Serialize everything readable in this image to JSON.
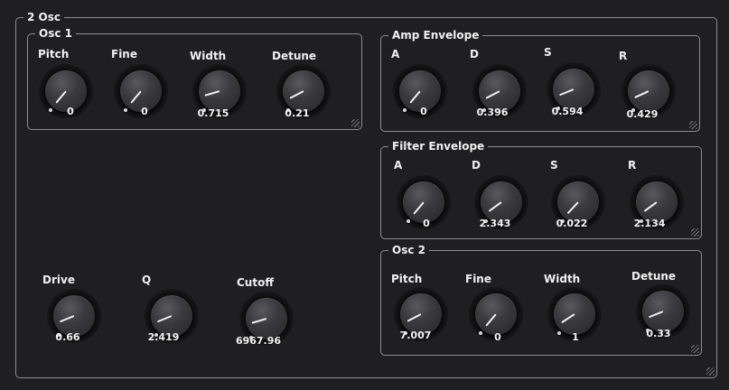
{
  "main": {
    "title": "2 Osc"
  },
  "osc1": {
    "title": "Osc 1",
    "knobs": [
      {
        "label": "Pitch",
        "value": "0",
        "level": 0.0
      },
      {
        "label": "Fine",
        "value": "0",
        "level": 0.0
      },
      {
        "label": "Width",
        "value": "0.715",
        "level": 0.12
      },
      {
        "label": "Detune",
        "value": "0.21",
        "level": 0.08
      }
    ]
  },
  "amp_env": {
    "title": "Amp Envelope",
    "knobs": [
      {
        "label": "A",
        "value": "0",
        "level": 0.0
      },
      {
        "label": "D",
        "value": "0.396",
        "level": 0.08
      },
      {
        "label": "S",
        "value": "0.594",
        "level": 0.1
      },
      {
        "label": "R",
        "value": "0.429",
        "level": 0.09
      }
    ]
  },
  "filter_env": {
    "title": "Filter Envelope",
    "knobs": [
      {
        "label": "A",
        "value": "0",
        "level": 0.0
      },
      {
        "label": "D",
        "value": "2.343",
        "level": 0.05
      },
      {
        "label": "S",
        "value": "0.022",
        "level": 0.01
      },
      {
        "label": "R",
        "value": "2.134",
        "level": 0.05
      }
    ]
  },
  "osc2": {
    "title": "Osc 2",
    "knobs": [
      {
        "label": "Pitch",
        "value": "7.007",
        "level": 0.08
      },
      {
        "label": "Fine",
        "value": "0",
        "level": 0.0
      },
      {
        "label": "Width",
        "value": "1",
        "level": 0.06
      },
      {
        "label": "Detune",
        "value": "0.33",
        "level": 0.1
      }
    ]
  },
  "filter": {
    "knobs": [
      {
        "label": "Drive",
        "value": "0.66",
        "level": 0.1
      },
      {
        "label": "Q",
        "value": "2.419",
        "level": 0.1
      },
      {
        "label": "Cutoff",
        "value": "6967.96",
        "level": 0.12
      }
    ]
  },
  "colors": {
    "background": "#1f1f21",
    "border": "#8e8e90",
    "text": "#f0f0f0"
  }
}
